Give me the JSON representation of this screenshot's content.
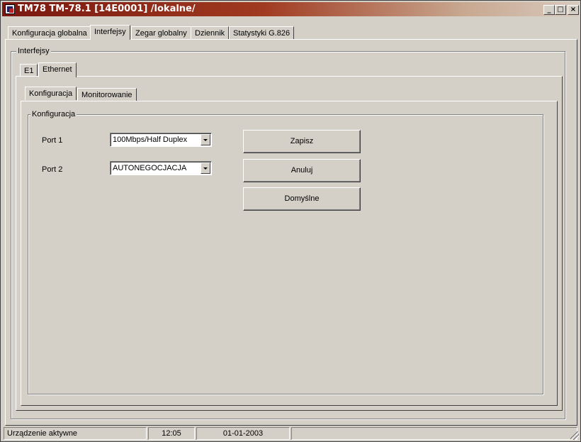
{
  "window": {
    "title": "TM78 TM-78.1 [14E0001] /lokalne/",
    "minimize_glyph": "_",
    "maximize_glyph": "□",
    "close_glyph": "×"
  },
  "main_tabs": [
    {
      "label": "Konfiguracja globalna"
    },
    {
      "label": "Interfejsy"
    },
    {
      "label": "Zegar globalny"
    },
    {
      "label": "Dziennik"
    },
    {
      "label": "Statystyki G.826"
    }
  ],
  "interfaces_group": {
    "legend": "Interfejsy"
  },
  "interface_tabs": [
    {
      "label": "E1"
    },
    {
      "label": "Ethernet"
    }
  ],
  "ethernet_tabs": [
    {
      "label": "Konfiguracja"
    },
    {
      "label": "Monitorowanie"
    }
  ],
  "config_group": {
    "legend": "Konfiguracja",
    "port1": {
      "label": "Port 1",
      "value": "100Mbps/Half Duplex"
    },
    "port2": {
      "label": "Port 2",
      "value": "AUTONEGOCJACJA"
    },
    "buttons": {
      "save": "Zapisz",
      "cancel": "Anuluj",
      "defaults": "Domyślne"
    }
  },
  "status": {
    "state": "Urządzenie aktywne",
    "time": "12:05",
    "date": "01-01-2003"
  }
}
